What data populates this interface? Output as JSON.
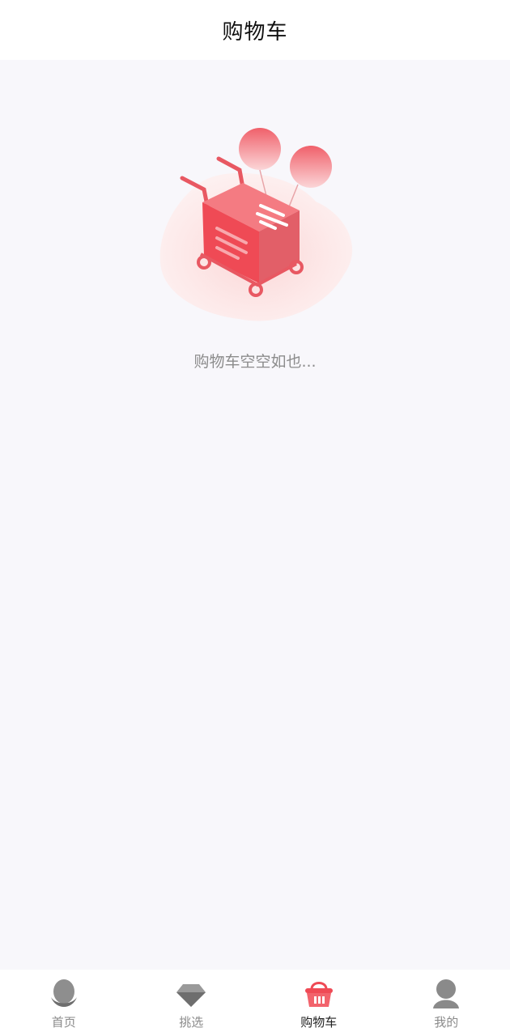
{
  "header": {
    "title": "购物车"
  },
  "empty_state": {
    "message": "购物车空空如也...",
    "illustration": "empty-cart-with-balloons"
  },
  "tabbar": {
    "active_index": 2,
    "active_color": "#ef4a55",
    "inactive_color": "#8a8a8a",
    "items": [
      {
        "label": "首页",
        "icon": "home-icon"
      },
      {
        "label": "挑选",
        "icon": "diamond-icon"
      },
      {
        "label": "购物车",
        "icon": "basket-icon"
      },
      {
        "label": "我的",
        "icon": "profile-icon"
      }
    ]
  }
}
